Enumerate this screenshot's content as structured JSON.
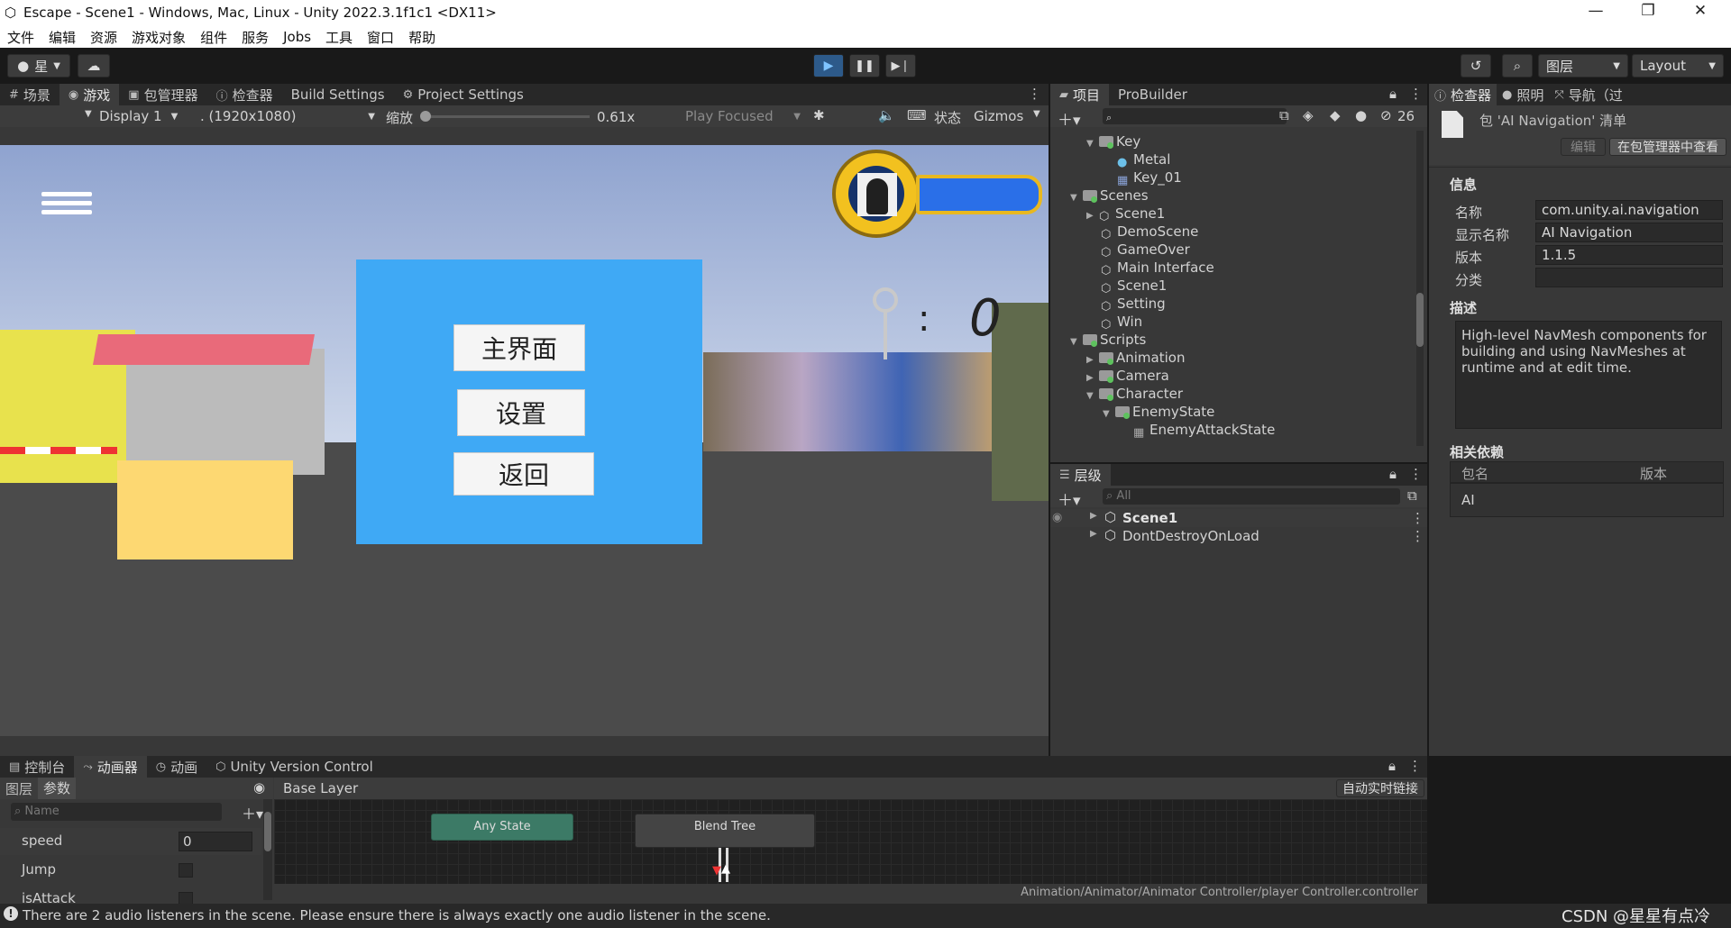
{
  "window": {
    "title": "Escape - Scene1 - Windows, Mac, Linux - Unity 2022.3.1f1c1 <DX11>"
  },
  "menu": [
    "文件",
    "编辑",
    "资源",
    "游戏对象",
    "组件",
    "服务",
    "Jobs",
    "工具",
    "窗口",
    "帮助"
  ],
  "toolbar": {
    "account_label": "星",
    "layers_label": "图层",
    "layout_label": "Layout"
  },
  "game_tabs": {
    "scene": "场景",
    "game": "游戏",
    "package_manager": "包管理器",
    "inspector": "检查器",
    "build_settings": "Build Settings",
    "project_settings": "Project Settings"
  },
  "game_toolbar": {
    "display": "Display 1",
    "resolution": ". (1920x1080)",
    "scale_label": "缩放",
    "scale_value": "0.61x",
    "play_mode": "Play Focused",
    "stats": "状态",
    "gizmos": "Gizmos"
  },
  "game_menu": {
    "main_button": "主界面",
    "settings_button": "设置",
    "back_button": "返回",
    "score": "0",
    "colon": ":"
  },
  "project": {
    "tabs": {
      "project": "项目",
      "probuilder": "ProBuilder"
    },
    "hidden_count": "26",
    "items": [
      {
        "label": "Key"
      },
      {
        "label": "Metal"
      },
      {
        "label": "Key_01"
      },
      {
        "label": "Scenes"
      },
      {
        "label": "Scene1"
      },
      {
        "label": "DemoScene"
      },
      {
        "label": "GameOver"
      },
      {
        "label": "Main Interface"
      },
      {
        "label": "Scene1"
      },
      {
        "label": "Setting"
      },
      {
        "label": "Win"
      },
      {
        "label": "Scripts"
      },
      {
        "label": "Animation"
      },
      {
        "label": "Camera"
      },
      {
        "label": "Character"
      },
      {
        "label": "EnemyState"
      },
      {
        "label": "EnemyAttackState"
      }
    ]
  },
  "hierarchy": {
    "tab": "层级",
    "search_placeholder": "All",
    "items": [
      {
        "label": "Scene1"
      },
      {
        "label": "DontDestroyOnLoad"
      }
    ]
  },
  "inspector": {
    "tabs": {
      "inspector": "检查器",
      "lighting": "照明",
      "navigation": "导航（过"
    },
    "header_title": "包 'AI Navigation' 清单",
    "edit_button": "编辑",
    "view_in_pm_button": "在包管理器中查看",
    "info_title": "信息",
    "fields": [
      {
        "label": "名称",
        "value": "com.unity.ai.navigation"
      },
      {
        "label": "显示名称",
        "value": "AI Navigation"
      },
      {
        "label": "版本",
        "value": "1.1.5"
      },
      {
        "label": "分类",
        "value": ""
      }
    ],
    "desc_title": "描述",
    "description": "High-level NavMesh components for building and using NavMeshes at runtime and at edit time.",
    "deps_title": "相关依赖",
    "deps_headers": {
      "name": "包名",
      "version": "版本"
    },
    "deps_rows": [
      {
        "name": "AI",
        "version": ""
      }
    ]
  },
  "bottom_tabs": {
    "console": "控制台",
    "animator": "动画器",
    "animation": "动画",
    "vcs": "Unity Version Control"
  },
  "animator": {
    "subtabs": {
      "layers": "图层",
      "params": "参数"
    },
    "search_placeholder": "Name",
    "breadcrumb": "Base Layer",
    "auto_live_link": "自动实时链接",
    "params": [
      {
        "name": "speed",
        "value": "0"
      },
      {
        "name": "Jump",
        "value": ""
      },
      {
        "name": "isAttack",
        "value": ""
      }
    ],
    "nodes": {
      "any_state": "Any State",
      "blend_tree": "Blend Tree"
    },
    "controller_path": "Animation/Animator/Animator Controller/player Controller.controller"
  },
  "status": {
    "message": "There are 2 audio listeners in the scene. Please ensure there is always exactly one audio listener in the scene.",
    "watermark": "CSDN @星星有点冷"
  },
  "colors": {
    "game_panel": "#3fa9f5",
    "accent_play": "#4a9eff",
    "any_state_node": "#3c7a66"
  }
}
